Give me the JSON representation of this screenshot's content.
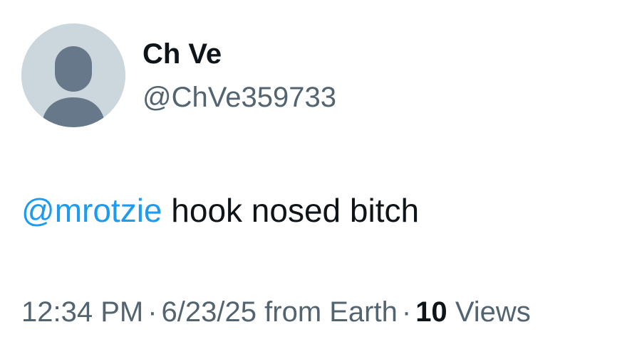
{
  "user": {
    "display_name": "Ch Ve",
    "handle": "@ChVe359733",
    "avatar_icon": "default-profile-silhouette-icon"
  },
  "tweet": {
    "mention": "@mrotzie",
    "text": " hook nosed bitch"
  },
  "meta": {
    "time": "12:34 PM",
    "separator": "·",
    "date": "6/23/25",
    "source": "from Earth",
    "views_count": "10",
    "views_label": "Views"
  },
  "colors": {
    "link": "#1d9bf0",
    "secondary_text": "#536471",
    "primary_text": "#0f1419",
    "avatar_bg": "#ccd6dd",
    "avatar_silhouette": "#657786"
  }
}
